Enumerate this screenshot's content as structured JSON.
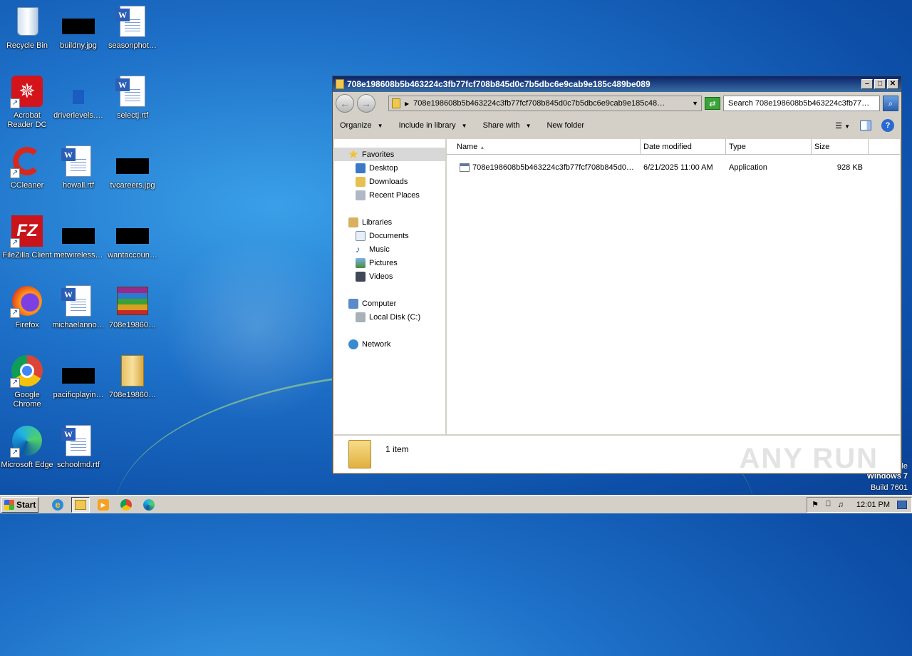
{
  "desktop": {
    "icons": [
      {
        "label": "Recycle Bin",
        "icon": "recycle-bin-icon"
      },
      {
        "label": "buildny.jpg",
        "icon": "image-thumbnail-icon"
      },
      {
        "label": "seasonphot…",
        "icon": "word-document-icon"
      },
      {
        "label": "Acrobat Reader DC",
        "icon": "acrobat-icon"
      },
      {
        "label": "driverlevels.…",
        "icon": "image-thumbnail-icon"
      },
      {
        "label": "selectj.rtf",
        "icon": "word-document-icon"
      },
      {
        "label": "CCleaner",
        "icon": "ccleaner-icon"
      },
      {
        "label": "howall.rtf",
        "icon": "word-document-icon"
      },
      {
        "label": "tvcareers.jpg",
        "icon": "image-thumbnail-icon"
      },
      {
        "label": "FileZilla Client",
        "icon": "filezilla-icon"
      },
      {
        "label": "metwireless…",
        "icon": "image-thumbnail-icon"
      },
      {
        "label": "wantaccoun…",
        "icon": "image-thumbnail-icon"
      },
      {
        "label": "Firefox",
        "icon": "firefox-icon"
      },
      {
        "label": "michaelanno…",
        "icon": "word-document-icon"
      },
      {
        "label": "708e19860…",
        "icon": "winrar-archive-icon"
      },
      {
        "label": "Google Chrome",
        "icon": "chrome-icon"
      },
      {
        "label": "pacificplayin…",
        "icon": "image-thumbnail-icon"
      },
      {
        "label": "708e19860…",
        "icon": "folder-icon"
      },
      {
        "label": "Microsoft Edge",
        "icon": "edge-icon"
      },
      {
        "label": "schoolmd.rtf",
        "icon": "word-document-icon"
      }
    ],
    "brand_lines": [
      "Windows 7",
      "Build 7601"
    ],
    "brand_partial": "le"
  },
  "explorer": {
    "title": "708e198608b5b463224c3fb77fcf708b845d0c7b5dbc6e9cab9e185c489be089",
    "address": "708e198608b5b463224c3fb77fcf708b845d0c7b5dbc6e9cab9e185c48…",
    "search_placeholder": "Search 708e198608b5b463224c3fb77…",
    "commands": {
      "organize": "Organize",
      "include": "Include in library",
      "share": "Share with",
      "new_folder": "New folder"
    },
    "nav": {
      "favorites": "Favorites",
      "desktop": "Desktop",
      "downloads": "Downloads",
      "recent": "Recent Places",
      "libraries": "Libraries",
      "documents": "Documents",
      "music": "Music",
      "pictures": "Pictures",
      "videos": "Videos",
      "computer": "Computer",
      "local_disk": "Local Disk (C:)",
      "network": "Network"
    },
    "columns": {
      "name": "Name",
      "date": "Date modified",
      "type": "Type",
      "size": "Size"
    },
    "files": [
      {
        "name": "708e198608b5b463224c3fb77fcf708b845d0…",
        "date": "6/21/2025 11:00 AM",
        "type": "Application",
        "size": "928 KB"
      }
    ],
    "status": "1 item",
    "watermark": "ANY RUN"
  },
  "taskbar": {
    "start": "Start",
    "clock": "12:01 PM"
  }
}
